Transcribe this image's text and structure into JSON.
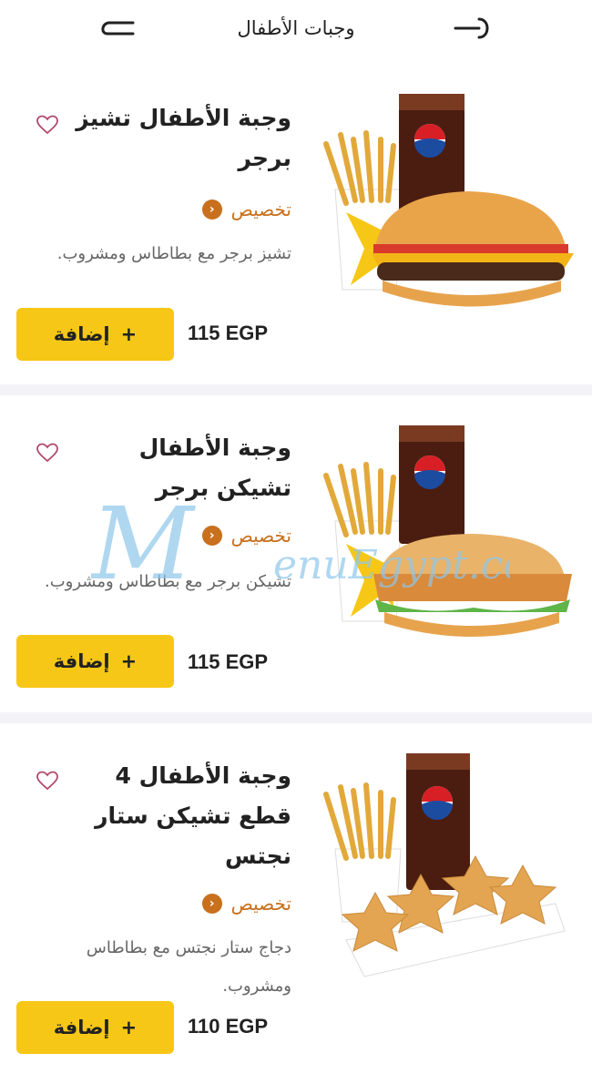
{
  "header": {
    "title": "وجبات الأطفال",
    "back_icon": "back-arrow-icon",
    "search_icon": "search-icon"
  },
  "items": [
    {
      "title": "وجبة الأطفال تشيز برجر",
      "customize_label": "تخصيص",
      "description": "تشيز برجر مع بطاطاس ومشروب.",
      "price": "115 EGP",
      "add_label": "إضافة",
      "add_symbol": "+",
      "image": "kids-cheeseburger-meal"
    },
    {
      "title": "وجبة الأطفال تشيكن برجر",
      "customize_label": "تخصيص",
      "description": "تشيكن برجر مع بطاطاس ومشروب.",
      "price": "115 EGP",
      "add_label": "إضافة",
      "add_symbol": "+",
      "image": "kids-chicken-burger-meal"
    },
    {
      "title": "وجبة الأطفال 4 قطع تشيكن ستار نجتس",
      "customize_label": "تخصيص",
      "description": "دجاج ستار نجتس مع بطاطاس ومشروب.",
      "price": "110 EGP",
      "add_label": "إضافة",
      "add_symbol": "+",
      "image": "kids-star-nuggets-meal"
    }
  ],
  "watermark": "MenuEgypt.com",
  "colors": {
    "accent": "#f6c716",
    "customize": "#c8701d",
    "heart": "#b04a6c"
  }
}
